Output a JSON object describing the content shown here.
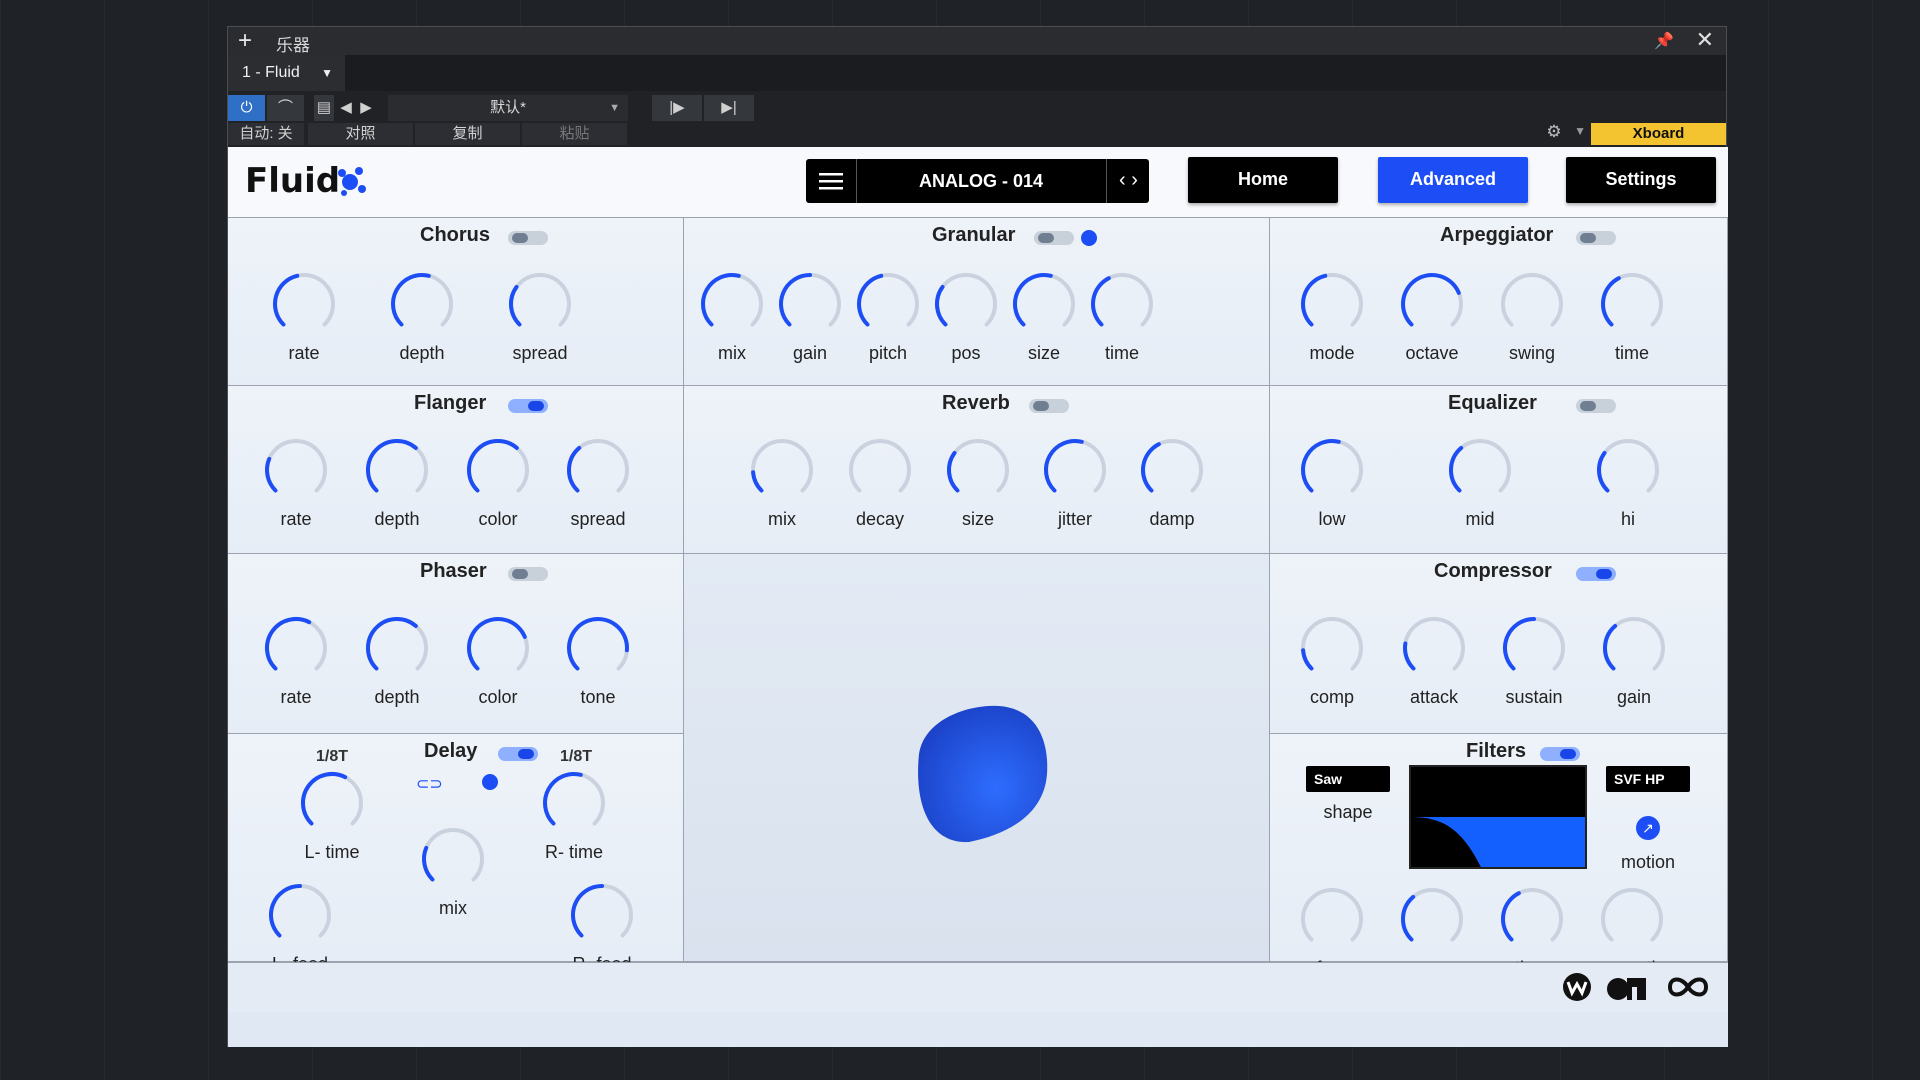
{
  "window": {
    "title": "乐器",
    "instrument": "1 - Fluid"
  },
  "toolbar": {
    "preset": "默认*",
    "auto": "自动: 关",
    "compare": "对照",
    "copy": "复制",
    "paste": "粘贴",
    "xboard": "Xboard"
  },
  "header": {
    "logo": "Fluid",
    "preset_name": "ANALOG - 014",
    "home": "Home",
    "advanced": "Advanced",
    "settings": "Settings"
  },
  "colors": {
    "accent": "#1d4ef5",
    "knob_track": "#c9d2de"
  },
  "sections": {
    "chorus": {
      "title": "Chorus",
      "enabled": false,
      "knobs": [
        {
          "label": "rate",
          "value": 0.45
        },
        {
          "label": "depth",
          "value": 0.55
        },
        {
          "label": "spread",
          "value": 0.3
        }
      ]
    },
    "granular": {
      "title": "Granular",
      "enabled": false,
      "knobs": [
        {
          "label": "mix",
          "value": 0.55
        },
        {
          "label": "gain",
          "value": 0.5
        },
        {
          "label": "pitch",
          "value": 0.45
        },
        {
          "label": "pos",
          "value": 0.3
        },
        {
          "label": "size",
          "value": 0.55
        },
        {
          "label": "time",
          "value": 0.4
        }
      ]
    },
    "arpeggiator": {
      "title": "Arpeggiator",
      "enabled": false,
      "knobs": [
        {
          "label": "mode",
          "value": 0.45
        },
        {
          "label": "octave",
          "value": 0.75
        },
        {
          "label": "swing",
          "value": 0.0
        },
        {
          "label": "time",
          "value": 0.4
        }
      ]
    },
    "flanger": {
      "title": "Flanger",
      "enabled": true,
      "knobs": [
        {
          "label": "rate",
          "value": 0.25
        },
        {
          "label": "depth",
          "value": 0.65
        },
        {
          "label": "color",
          "value": 0.65
        },
        {
          "label": "spread",
          "value": 0.35
        }
      ]
    },
    "reverb": {
      "title": "Reverb",
      "enabled": false,
      "knobs": [
        {
          "label": "mix",
          "value": 0.15
        },
        {
          "label": "decay",
          "value": 0.0
        },
        {
          "label": "size",
          "value": 0.3
        },
        {
          "label": "jitter",
          "value": 0.55
        },
        {
          "label": "damp",
          "value": 0.4
        }
      ]
    },
    "equalizer": {
      "title": "Equalizer",
      "enabled": false,
      "knobs": [
        {
          "label": "low",
          "value": 0.55
        },
        {
          "label": "mid",
          "value": 0.35
        },
        {
          "label": "hi",
          "value": 0.3
        }
      ]
    },
    "phaser": {
      "title": "Phaser",
      "enabled": false,
      "knobs": [
        {
          "label": "rate",
          "value": 0.6
        },
        {
          "label": "depth",
          "value": 0.65
        },
        {
          "label": "color",
          "value": 0.75
        },
        {
          "label": "tone",
          "value": 0.85
        }
      ]
    },
    "compressor": {
      "title": "Compressor",
      "enabled": true,
      "knobs": [
        {
          "label": "comp",
          "value": 0.15
        },
        {
          "label": "attack",
          "value": 0.2
        },
        {
          "label": "sustain",
          "value": 0.5
        },
        {
          "label": "gain",
          "value": 0.35
        }
      ]
    },
    "delay": {
      "title": "Delay",
      "enabled": true,
      "left_sync": "1/8T",
      "right_sync": "1/8T",
      "knobs": [
        {
          "label": "L- time",
          "value": 0.6
        },
        {
          "label": "R- time",
          "value": 0.55
        },
        {
          "label": "mix",
          "value": 0.25
        },
        {
          "label": "L- feed",
          "value": 0.5
        },
        {
          "label": "R- feed",
          "value": 0.5
        }
      ]
    },
    "filters": {
      "title": "Filters",
      "enabled": true,
      "shape_value": "Saw",
      "shape_label": "shape",
      "type_value": "SVF HP",
      "motion_label": "motion",
      "knobs": [
        {
          "label": "freq",
          "value": 0.0
        },
        {
          "label": "res",
          "value": 0.35
        },
        {
          "label": "time",
          "value": 0.4
        },
        {
          "label": "smooth",
          "value": 0.0
        }
      ]
    }
  }
}
